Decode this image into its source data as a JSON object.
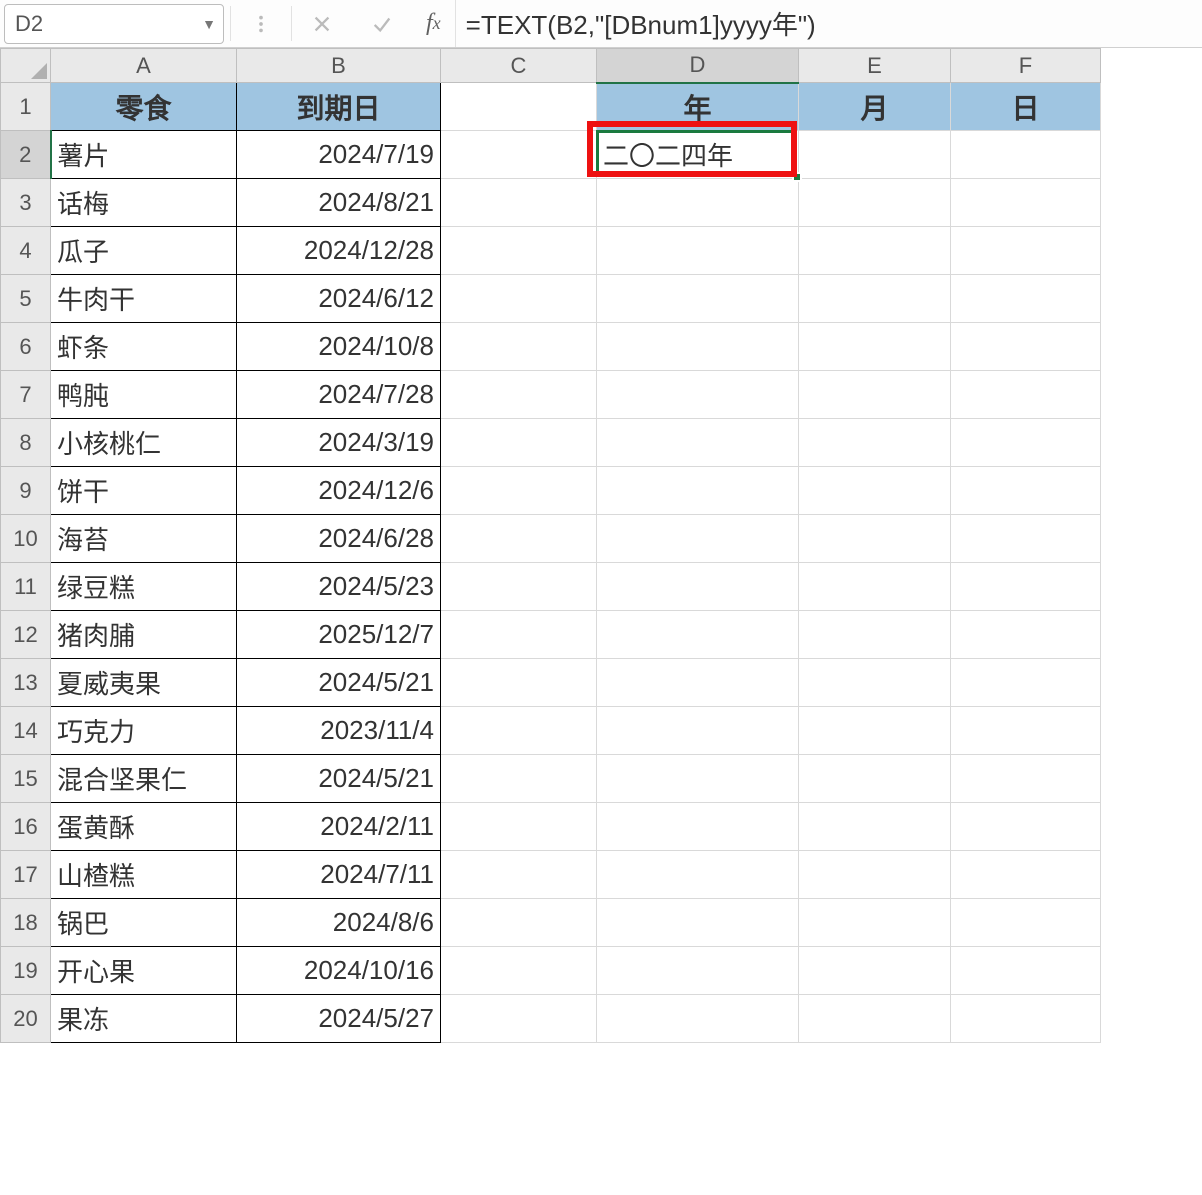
{
  "nameBox": "D2",
  "formula": "=TEXT(B2,\"[DBnum1]yyyy年\")",
  "columns": [
    "A",
    "B",
    "C",
    "D",
    "E",
    "F"
  ],
  "rowCount": 20,
  "selectedCell": {
    "col": "D",
    "row": 2
  },
  "headers": {
    "A": "零食",
    "B": "到期日",
    "D": "年",
    "E": "月",
    "F": "日"
  },
  "colA": [
    "薯片",
    "话梅",
    "瓜子",
    "牛肉干",
    "虾条",
    "鸭肫",
    "小核桃仁",
    "饼干",
    "海苔",
    "绿豆糕",
    "猪肉脯",
    "夏威夷果",
    "巧克力",
    "混合坚果仁",
    "蛋黄酥",
    "山楂糕",
    "锅巴",
    "开心果",
    "果冻"
  ],
  "colB": [
    "2024/7/19",
    "2024/8/21",
    "2024/12/28",
    "2024/6/12",
    "2024/10/8",
    "2024/7/28",
    "2024/3/19",
    "2024/12/6",
    "2024/6/28",
    "2024/5/23",
    "2025/12/7",
    "2024/5/21",
    "2023/11/4",
    "2024/5/21",
    "2024/2/11",
    "2024/7/11",
    "2024/8/6",
    "2024/10/16",
    "2024/5/27"
  ],
  "d2": "二〇二四年"
}
